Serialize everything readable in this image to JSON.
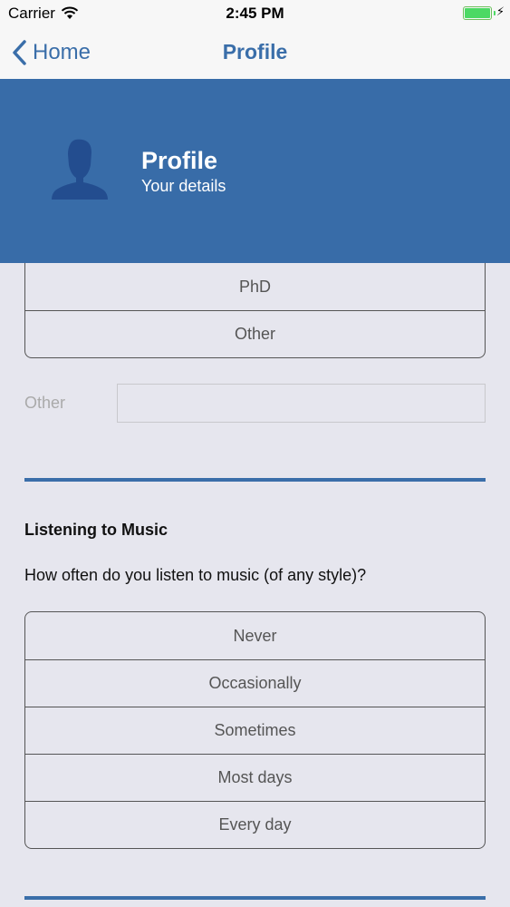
{
  "status_bar": {
    "carrier": "Carrier",
    "time": "2:45 PM"
  },
  "nav": {
    "back_label": "Home",
    "title": "Profile"
  },
  "header": {
    "title": "Profile",
    "subtitle": "Your details"
  },
  "education": {
    "options": [
      "PhD",
      "Other"
    ]
  },
  "other_field": {
    "label": "Other",
    "value": "",
    "placeholder": ""
  },
  "music": {
    "heading": "Listening to Music",
    "question": "How often do you listen to music (of any style)?",
    "options": [
      "Never",
      "Occasionally",
      "Sometimes",
      "Most days",
      "Every day"
    ]
  },
  "colors": {
    "accent": "#3a6ea9",
    "header_bg": "#386ca8",
    "page_bg": "#e6e6ee"
  }
}
